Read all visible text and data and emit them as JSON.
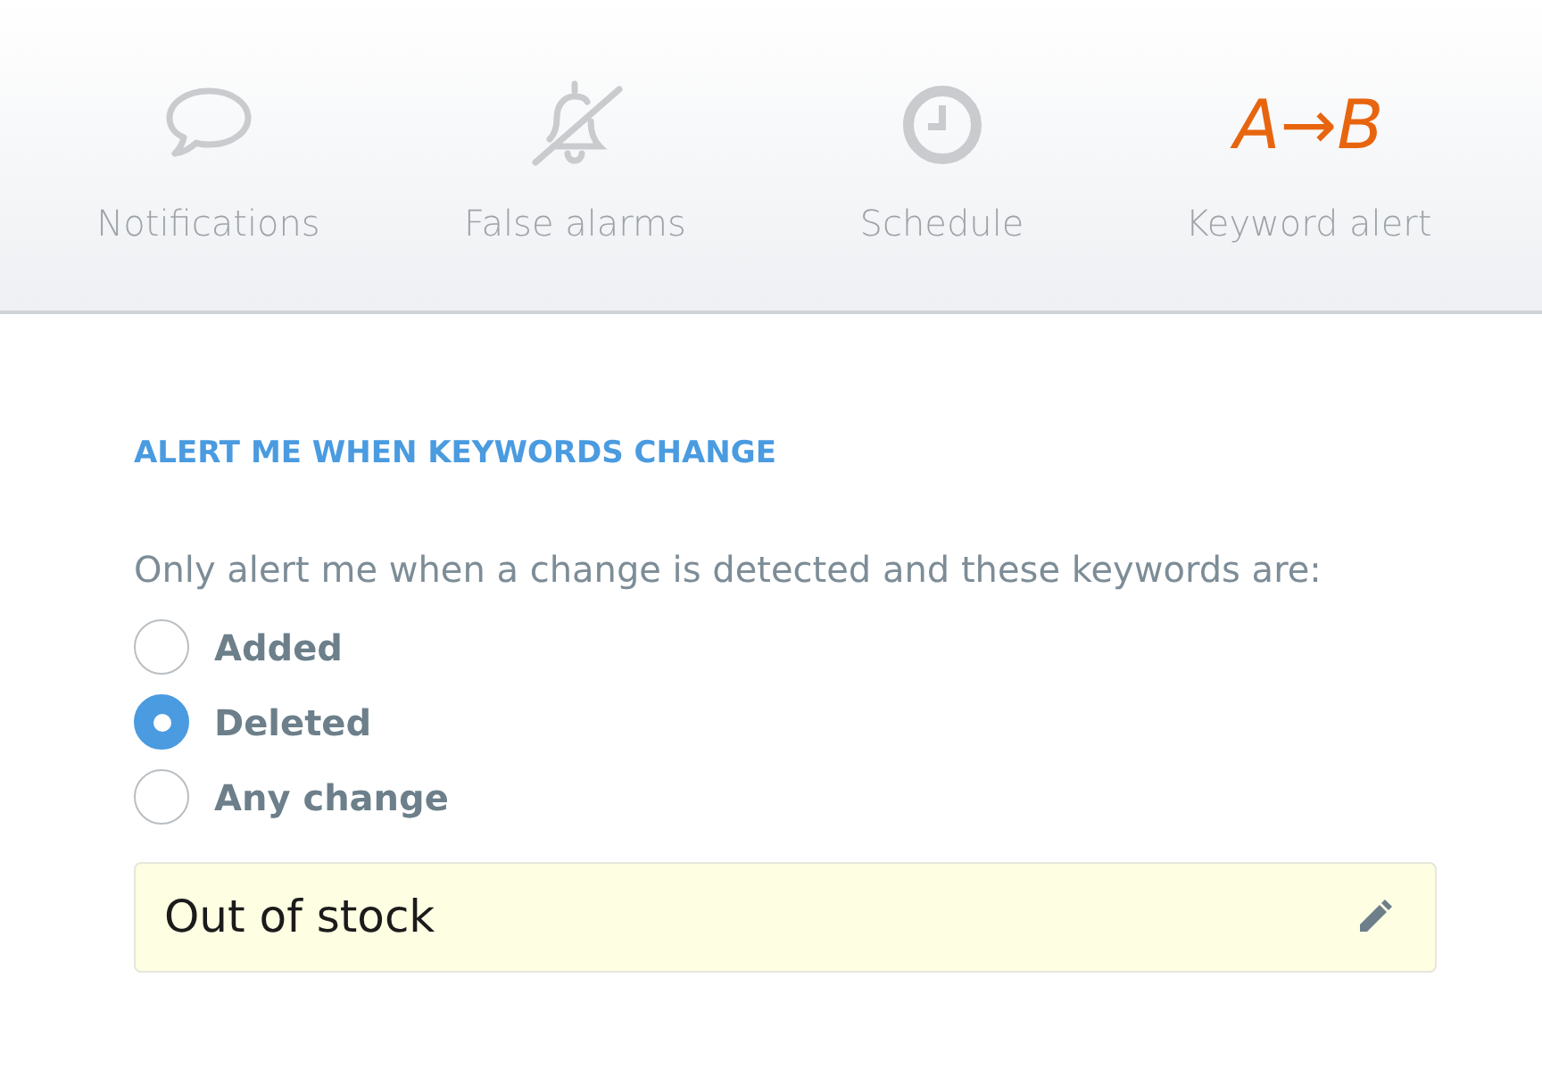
{
  "tabs": [
    {
      "label": "Notifications",
      "kind": "speech",
      "selected": false
    },
    {
      "label": "False alarms",
      "kind": "bell",
      "selected": false
    },
    {
      "label": "Schedule",
      "kind": "clock",
      "selected": false
    },
    {
      "label": "Keyword alert",
      "kind": "text",
      "icon_text": "A→B",
      "selected": true
    }
  ],
  "section": {
    "heading": "ALERT ME WHEN KEYWORDS CHANGE",
    "prompt": "Only alert me when a change is detected and these keywords are:",
    "options": [
      {
        "label": "Added",
        "selected": false
      },
      {
        "label": "Deleted",
        "selected": true
      },
      {
        "label": "Any change",
        "selected": false
      }
    ],
    "keyword_field": {
      "value": "Out of stock"
    }
  }
}
